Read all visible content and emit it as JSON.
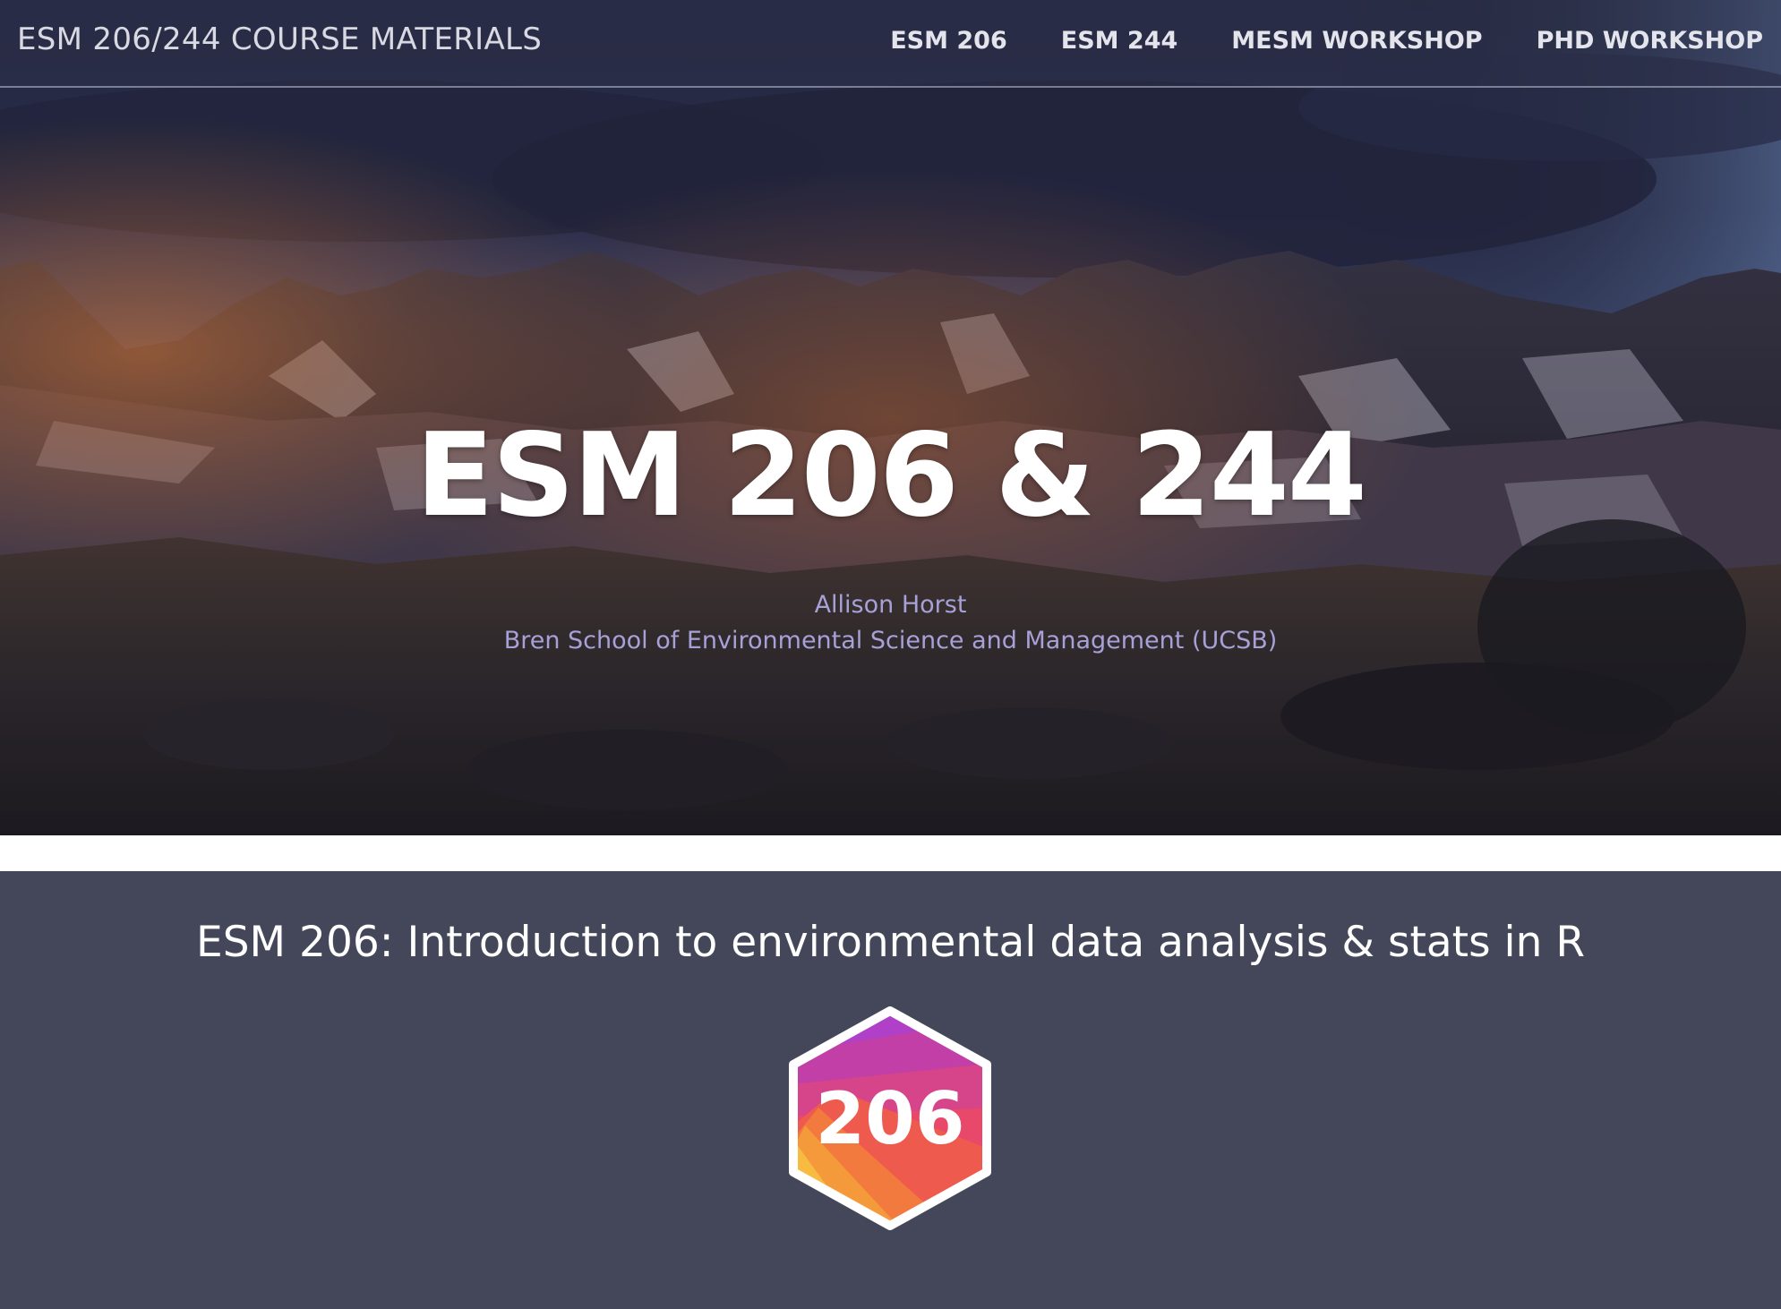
{
  "navbar": {
    "brand": "ESM 206/244 COURSE MATERIALS",
    "links": [
      "ESM 206",
      "ESM 244",
      "MESM WORKSHOP",
      "PHD WORKSHOP"
    ]
  },
  "hero": {
    "title": "ESM 206 & 244",
    "author": "Allison Horst",
    "affiliation": "Bren School of Environmental Science and Management (UCSB)"
  },
  "course": {
    "heading": "ESM 206: Introduction to environmental data analysis & stats in R",
    "logo_label": "206"
  },
  "colors": {
    "section_bg": "#434759",
    "subtitle": "#a7a1d8",
    "hex_border": "#ffffff"
  }
}
